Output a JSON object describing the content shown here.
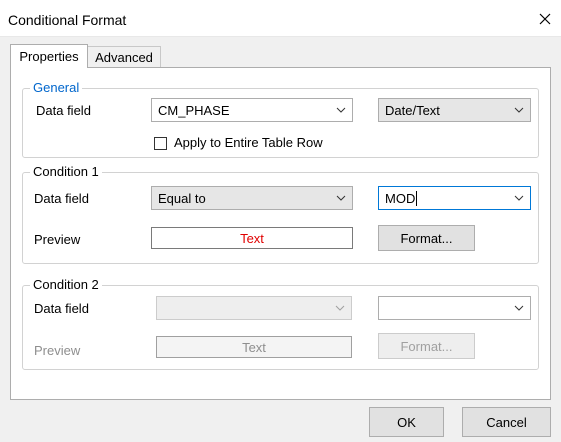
{
  "window": {
    "title": "Conditional Format"
  },
  "tabs": [
    {
      "label": "Properties",
      "active": true
    },
    {
      "label": "Advanced",
      "active": false
    }
  ],
  "general": {
    "legend": "General",
    "data_field_label": "Data field",
    "data_field_value": "CM_PHASE",
    "type_value": "Date/Text",
    "apply_row_label": "Apply to Entire Table Row",
    "apply_row_checked": false
  },
  "condition1": {
    "legend": "Condition 1",
    "data_field_label": "Data field",
    "operator_value": "Equal to",
    "compare_value": "MOD",
    "preview_label": "Preview",
    "preview_text": "Text",
    "preview_color": "#e00000",
    "format_button": "Format..."
  },
  "condition2": {
    "legend": "Condition 2",
    "data_field_label": "Data field",
    "operator_value": "",
    "compare_value": "",
    "preview_label": "Preview",
    "preview_text": "Text",
    "format_button": "Format..."
  },
  "footer": {
    "ok_label": "OK",
    "cancel_label": "Cancel"
  },
  "colors": {
    "accent": "#0078d7",
    "legend_blue": "#0066cc"
  }
}
